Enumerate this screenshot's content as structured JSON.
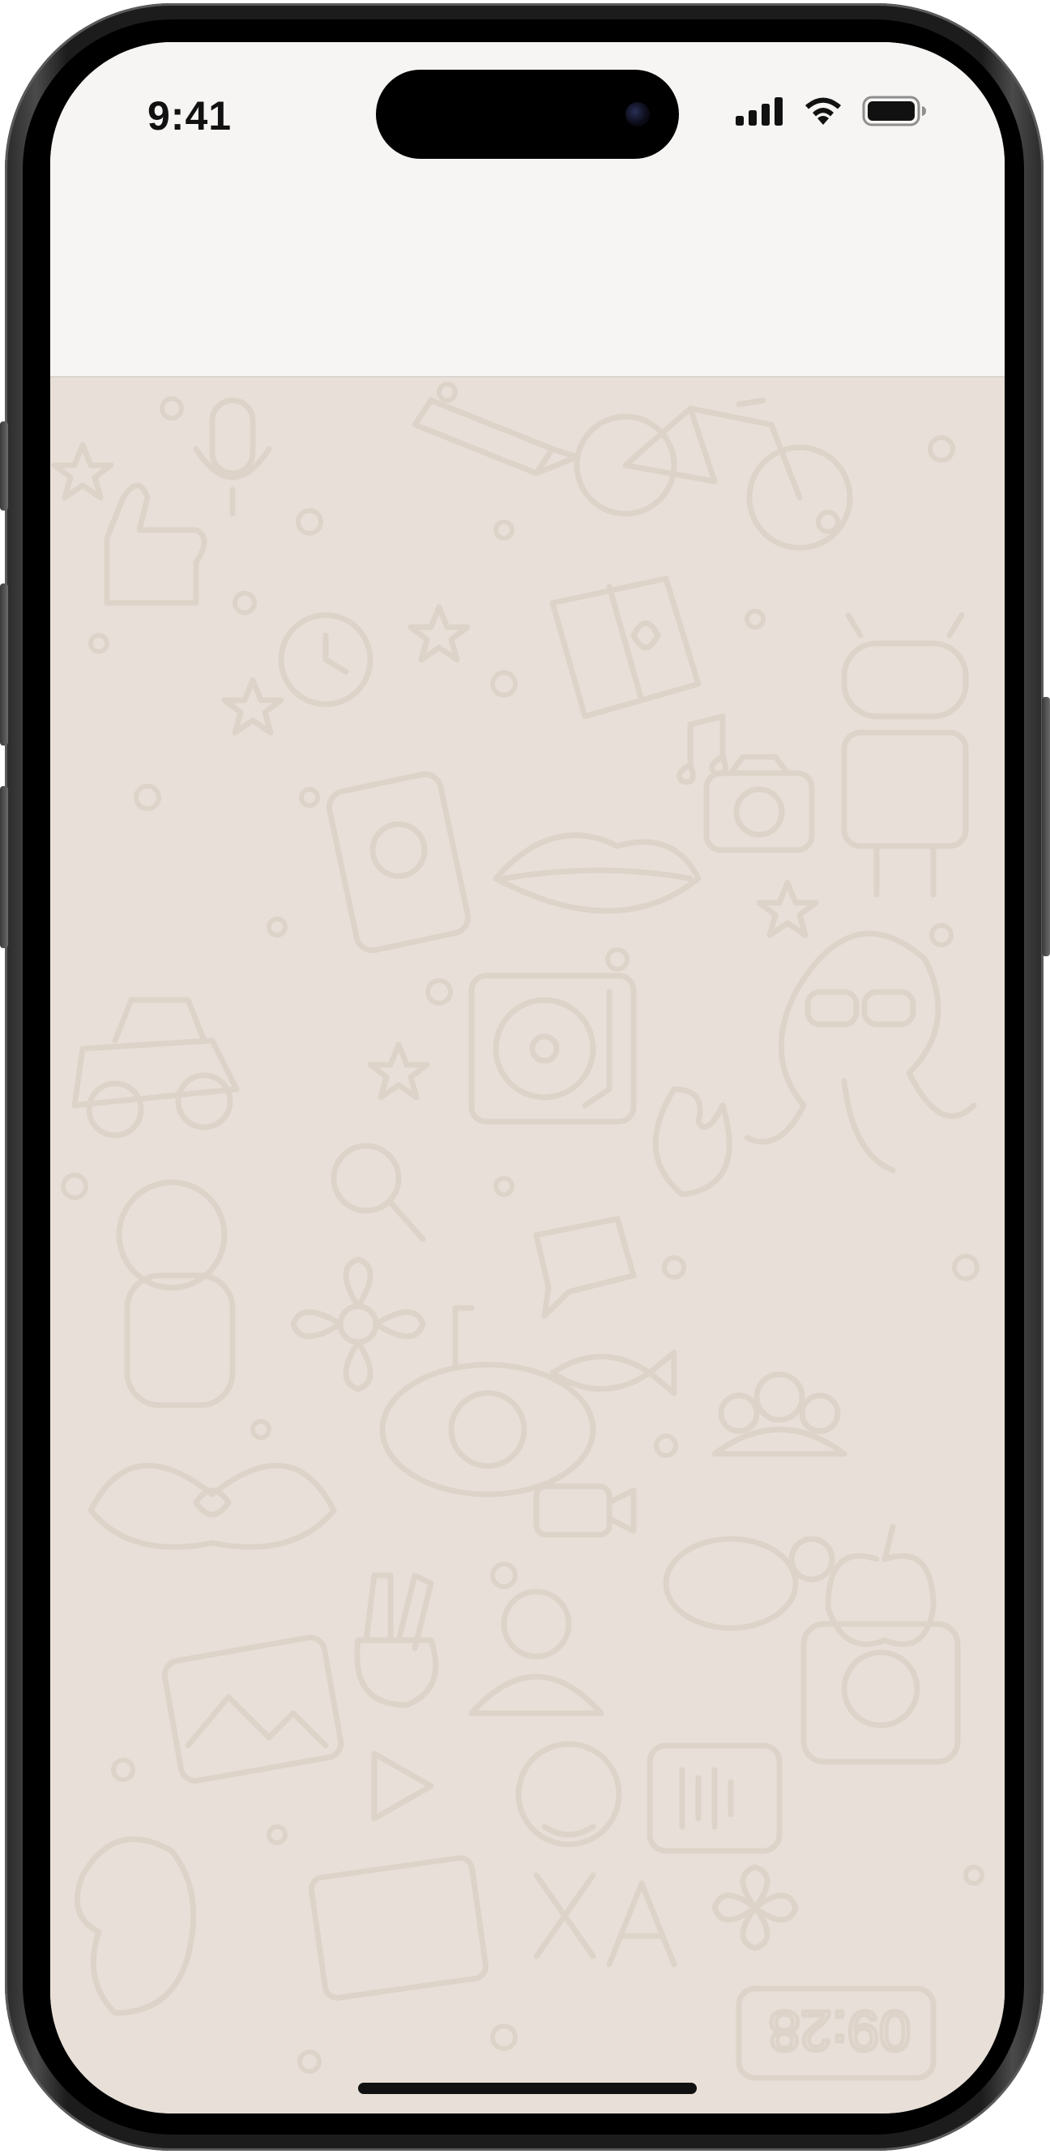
{
  "status_bar": {
    "time": "9:41",
    "signal_icon": "cellular-signal-icon",
    "wifi_icon": "wifi-icon",
    "battery_icon": "battery-icon"
  },
  "colors": {
    "header_bg": "#f6f5f3",
    "chat_bg": "#e8e0d8",
    "doodle_stroke": "#ddd3c9"
  },
  "wallpaper": {
    "clock_text": "09:28"
  }
}
